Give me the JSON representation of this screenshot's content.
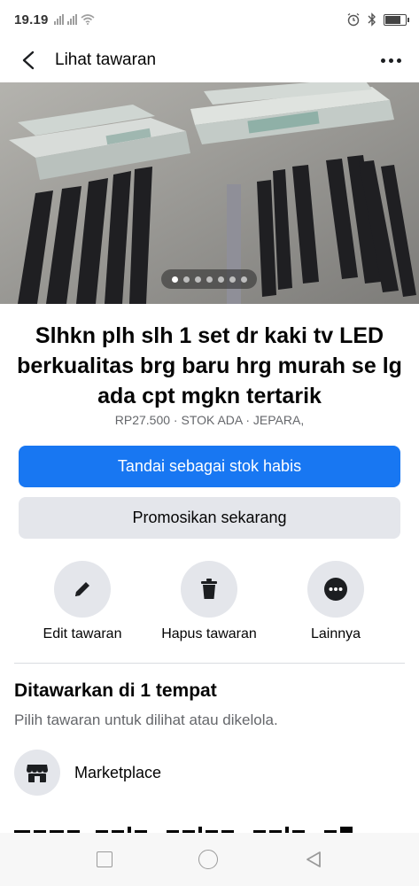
{
  "status_bar": {
    "time": "19.19"
  },
  "header": {
    "title": "Lihat tawaran"
  },
  "photo": {
    "carousel_count": 7,
    "active_index": 0
  },
  "listing": {
    "title": "Slhkn plh slh 1 set dr kaki tv LED berkualitas brg baru hrg murah se lg ada cpt mgkn tertarik",
    "meta": "RP27.500 · STOK ADA · JEPARA,"
  },
  "buttons": {
    "primary": "Tandai sebagai stok habis",
    "secondary": "Promosikan sekarang"
  },
  "actions": [
    {
      "label": "Edit tawaran",
      "icon": "pencil-icon"
    },
    {
      "label": "Hapus tawaran",
      "icon": "trash-icon"
    },
    {
      "label": "Lainnya",
      "icon": "more-dots-icon"
    }
  ],
  "offered_section": {
    "title": "Ditawarkan di 1 tempat",
    "subtitle": "Pilih tawaran untuk dilihat atau dikelola.",
    "places": [
      {
        "label": "Marketplace",
        "icon": "marketplace-store-icon"
      }
    ]
  },
  "colors": {
    "accent": "#1877f2",
    "secondary_bg": "#e4e6eb"
  }
}
